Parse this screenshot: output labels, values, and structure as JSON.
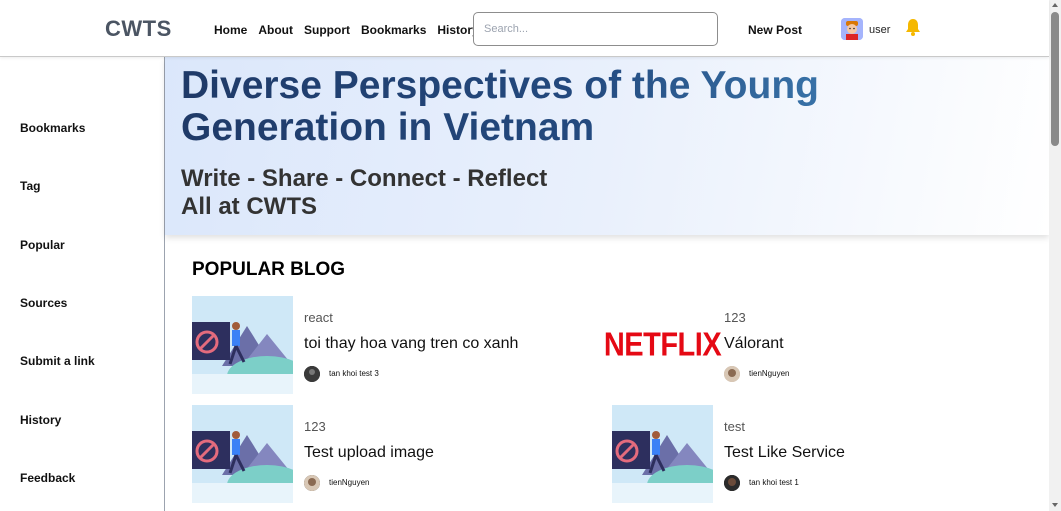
{
  "header": {
    "logo": "CWTS",
    "nav": [
      "Home",
      "About",
      "Support",
      "Bookmarks",
      "History"
    ],
    "search_placeholder": "Search...",
    "new_post": "New Post",
    "username": "user"
  },
  "sidebar": {
    "items": [
      "Bookmarks",
      "Tag",
      "Popular",
      "Sources",
      "Submit a link",
      "History",
      "Feedback"
    ]
  },
  "hero": {
    "title": "Diverse Perspectives of the Young Generation in Vietnam",
    "subtitle_line1": "Write - Share - Connect - Reflect",
    "subtitle_line2": "All at CWTS"
  },
  "main": {
    "section_title": "POPULAR BLOG",
    "posts": [
      {
        "tag": "react",
        "title": "toi thay hoa vang tren co xanh",
        "author": "tan khoi test 3",
        "thumb": "illustration"
      },
      {
        "tag": "123",
        "title": "Válorant",
        "author": "tienNguyen",
        "thumb": "netflix",
        "thumb_text": "NETFLIX"
      },
      {
        "tag": "123",
        "title": "Test upload image",
        "author": "tienNguyen",
        "thumb": "illustration"
      },
      {
        "tag": "test",
        "title": "Test Like Service",
        "author": "tan khoi test 1",
        "thumb": "illustration"
      }
    ]
  },
  "colors": {
    "hero_title_start": "#1f3a68",
    "hero_title_end": "#3f7fb5",
    "netflix_red": "#e50914",
    "bell": "#f5b800"
  },
  "icons": {
    "bell": "bell-icon",
    "avatar": "user-avatar-icon"
  }
}
